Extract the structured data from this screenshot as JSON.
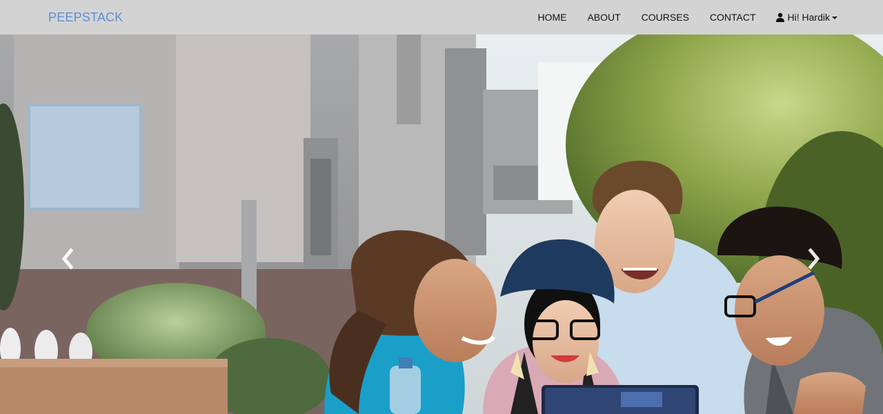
{
  "navbar": {
    "brand": "PEEPSTACK",
    "links": [
      {
        "label": "HOME"
      },
      {
        "label": "ABOUT"
      },
      {
        "label": "COURSES"
      },
      {
        "label": "CONTACT"
      }
    ],
    "user_menu": {
      "label": "Hi! Hardik",
      "icon": "user-icon"
    }
  },
  "carousel": {
    "controls": {
      "prev_icon": "chevron-left-icon",
      "next_icon": "chevron-right-icon"
    }
  },
  "colors": {
    "navbar_bg": "#d3d3d3",
    "brand": "#5b8fd6",
    "nav_text": "#111111"
  }
}
